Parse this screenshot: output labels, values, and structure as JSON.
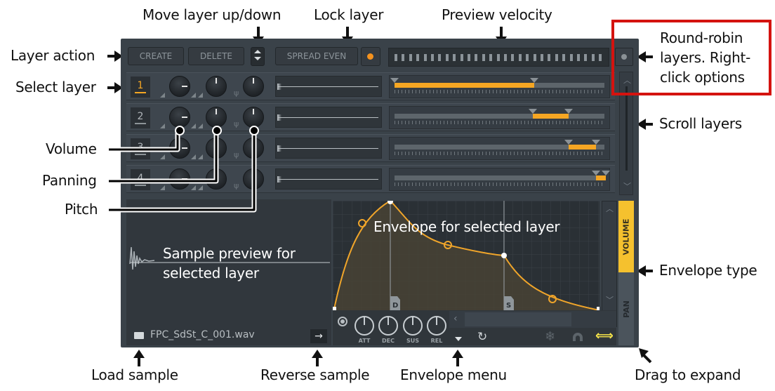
{
  "annotations": {
    "move_layer": "Move layer up/down",
    "lock_layer": "Lock layer",
    "preview_velocity": "Preview velocity",
    "round_robin": [
      "Round-robin",
      "layers. Right-",
      "click options"
    ],
    "layer_action": "Layer action",
    "select_layer": "Select layer",
    "scroll_layers": "Scroll layers",
    "volume": "Volume",
    "panning": "Panning",
    "pitch": "Pitch",
    "envelope_for_selected": "Envelope for selected layer",
    "sample_preview": [
      "Sample preview for",
      "selected layer"
    ],
    "envelope_type": "Envelope type",
    "load_sample": "Load sample",
    "reverse_sample": "Reverse sample",
    "envelope_menu": "Envelope menu",
    "drag_to_expand": "Drag to expand"
  },
  "toolbar": {
    "create_label": "CREATE",
    "delete_label": "DELETE",
    "spread_even_label": "SPREAD EVEN",
    "lock_active": true
  },
  "colors": {
    "accent": "#f5a623",
    "panel": "#3a4249",
    "annotation_box": "#d4130f",
    "expand_icon": "#f7e54a"
  },
  "layers": [
    {
      "number": "1",
      "selected": true,
      "range_start": 0.0,
      "range_end": 0.66
    },
    {
      "number": "2",
      "selected": false,
      "range_start": 0.655,
      "range_end": 0.825
    },
    {
      "number": "3",
      "selected": false,
      "range_start": 0.825,
      "range_end": 0.955
    },
    {
      "number": "4",
      "selected": false,
      "range_start": 0.955,
      "range_end": 1.0
    }
  ],
  "sample": {
    "file_name": "FPC_SdSt_C_001.wav",
    "reverse_icon": "→"
  },
  "envelope": {
    "knobs": [
      "ATT",
      "DEC",
      "SUS",
      "REL"
    ],
    "markers": [
      "D",
      "S"
    ],
    "tabs": [
      "VOLUME",
      "PAN"
    ],
    "active_tab": "VOLUME"
  }
}
